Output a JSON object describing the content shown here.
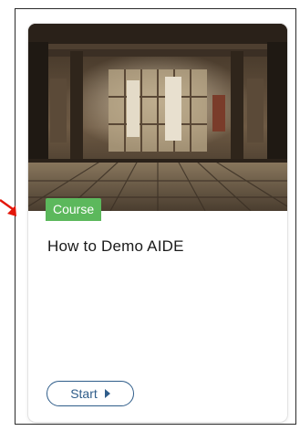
{
  "card": {
    "badge": "Course",
    "title": "How to Demo AIDE",
    "start_label": "Start"
  },
  "colors": {
    "badge": "#5cb85c",
    "button": "#2f5d8a",
    "arrow": "#e3170a"
  },
  "icons": {
    "start": "play-icon",
    "pointer": "red-arrow-icon"
  }
}
